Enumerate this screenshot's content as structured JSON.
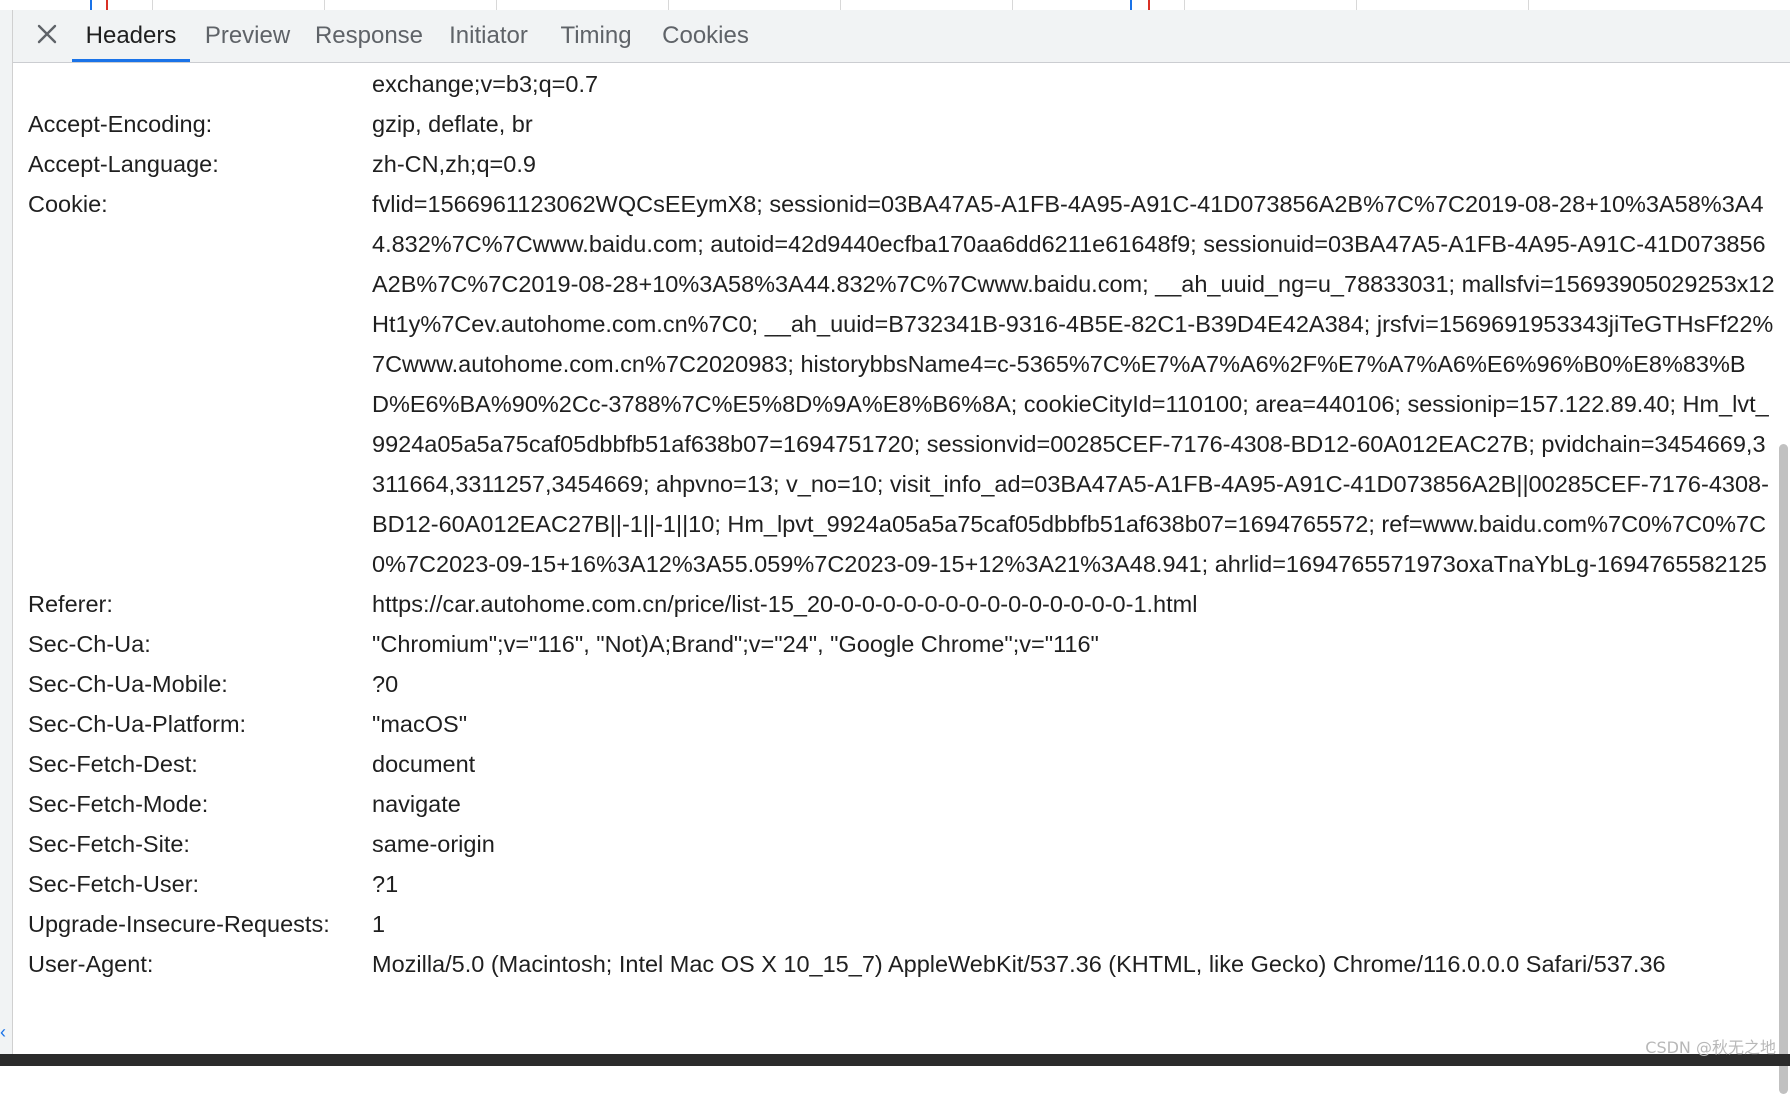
{
  "tabs": [
    {
      "label": "Headers",
      "active": true
    },
    {
      "label": "Preview",
      "active": false
    },
    {
      "label": "Response",
      "active": false
    },
    {
      "label": "Initiator",
      "active": false
    },
    {
      "label": "Timing",
      "active": false
    },
    {
      "label": "Cookies",
      "active": false
    }
  ],
  "headers": [
    {
      "name": "",
      "value": "exchange;v=b3;q=0.7"
    },
    {
      "name": "Accept-Encoding:",
      "value": "gzip, deflate, br"
    },
    {
      "name": "Accept-Language:",
      "value": "zh-CN,zh;q=0.9"
    },
    {
      "name": "Cookie:",
      "value": "fvlid=1566961123062WQCsEEymX8; sessionid=03BA47A5-A1FB-4A95-A91C-41D073856A2B%7C%7C2019-08-28+10%3A58%3A44.832%7C%7Cwww.baidu.com; autoid=42d9440ecfba170aa6dd6211e61648f9; sessionuid=03BA47A5-A1FB-4A95-A91C-41D073856A2B%7C%7C2019-08-28+10%3A58%3A44.832%7C%7Cwww.baidu.com; __ah_uuid_ng=u_78833031; mallsfvi=15693905029253x12Ht1y%7Cev.autohome.com.cn%7C0; __ah_uuid=B732341B-9316-4B5E-82C1-B39D4E42A384; jrsfvi=1569691953343jiTeGTHsFf22%7Cwww.autohome.com.cn%7C2020983; historybbsName4=c-5365%7C%E7%A7%A6%2F%E7%A7%A6%E6%96%B0%E8%83%BD%E6%BA%90%2Cc-3788%7C%E5%8D%9A%E8%B6%8A; cookieCityId=110100; area=440106; sessionip=157.122.89.40; Hm_lvt_9924a05a5a75caf05dbbfb51af638b07=1694751720; sessionvid=00285CEF-7176-4308-BD12-60A012EAC27B; pvidchain=3454669,3311664,3311257,3454669; ahpvno=13; v_no=10; visit_info_ad=03BA47A5-A1FB-4A95-A91C-41D073856A2B||00285CEF-7176-4308-BD12-60A012EAC27B||-1||-1||10; Hm_lpvt_9924a05a5a75caf05dbbfb51af638b07=1694765572; ref=www.baidu.com%7C0%7C0%7C0%7C2023-09-15+16%3A12%3A55.059%7C2023-09-15+12%3A21%3A48.941; ahrlid=1694765571973oxaTnaYbLg-1694765582125"
    },
    {
      "name": "Referer:",
      "value": "https://car.autohome.com.cn/price/list-15_20-0-0-0-0-0-0-0-0-0-0-0-0-0-0-1.html"
    },
    {
      "name": "Sec-Ch-Ua:",
      "value": "\"Chromium\";v=\"116\", \"Not)A;Brand\";v=\"24\", \"Google Chrome\";v=\"116\""
    },
    {
      "name": "Sec-Ch-Ua-Mobile:",
      "value": "?0"
    },
    {
      "name": "Sec-Ch-Ua-Platform:",
      "value": "\"macOS\""
    },
    {
      "name": "Sec-Fetch-Dest:",
      "value": "document"
    },
    {
      "name": "Sec-Fetch-Mode:",
      "value": "navigate"
    },
    {
      "name": "Sec-Fetch-Site:",
      "value": "same-origin"
    },
    {
      "name": "Sec-Fetch-User:",
      "value": "?1"
    },
    {
      "name": "Upgrade-Insecure-Requests:",
      "value": "1"
    },
    {
      "name": "User-Agent:",
      "value": "Mozilla/5.0 (Macintosh; Intel Mac OS X 10_15_7) AppleWebKit/537.36 (KHTML, like Gecko) Chrome/116.0.0.0 Safari/537.36"
    }
  ],
  "watermark": "CSDN @秋无之地",
  "colors": {
    "accent": "#1a73e8",
    "tabbar_bg": "#f1f3f4",
    "text": "#1f1f1f",
    "muted_text": "#5f6368"
  },
  "icons": {
    "close": "close-icon"
  }
}
